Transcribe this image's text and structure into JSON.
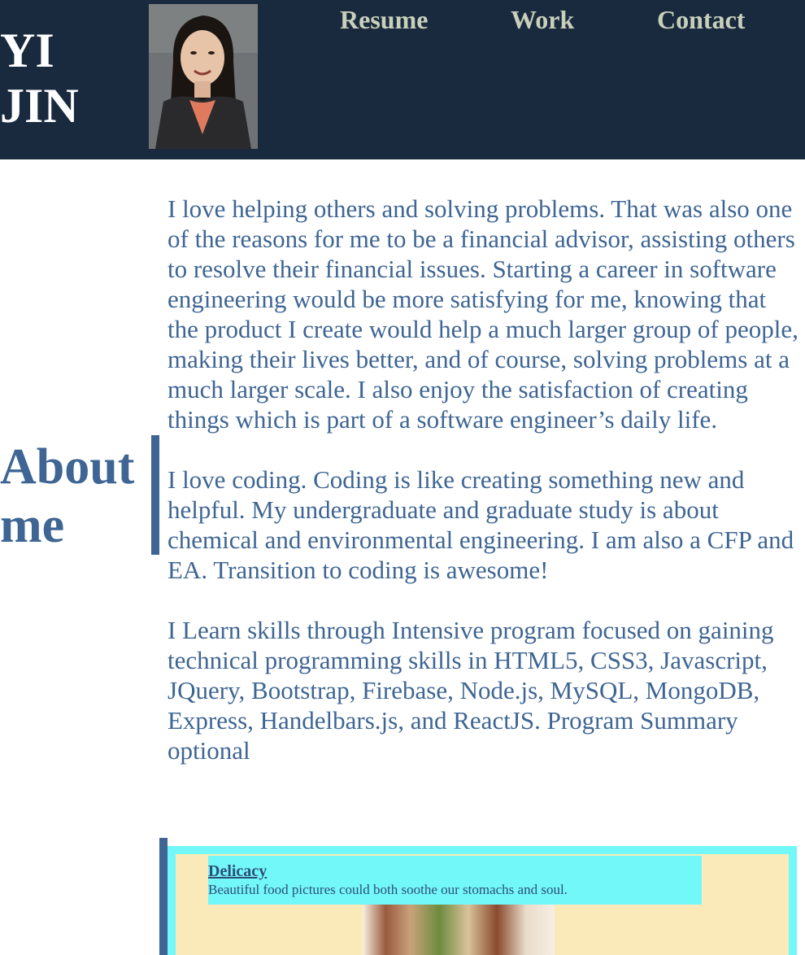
{
  "header": {
    "brand_line1": "YI",
    "brand_line2": "JIN",
    "avatar_alt": "profile photo",
    "nav": [
      {
        "label": "Resume"
      },
      {
        "label": "Work"
      },
      {
        "label": "Contact"
      }
    ]
  },
  "about": {
    "heading_line1": "About",
    "heading_line2": "me",
    "paragraphs": [
      "I love helping others and solving problems. That was also one of the reasons for me to be a financial advisor, assisting others to resolve their financial issues. Starting a career in software engineering would be more satisfying for me, knowing that the product I create would help a much larger group of people, making their lives better, and of course, solving problems at a much larger scale. I also enjoy the satisfaction of creating things which is part of a software engineer’s daily life.",
      "I love coding. Coding is like creating something new and helpful. My undergraduate and graduate study is about chemical and environmental engineering. I am also a CFP and EA. Transition to coding is awesome!",
      "I Learn skills through Intensive program focused on gaining technical programming skills in HTML5, CSS3, Javascript, JQuery, Bootstrap, Firebase, Node.js, MySQL, MongoDB, Express, Handelbars.js, and ReactJS. Program Summary optional"
    ]
  },
  "project": {
    "title": "Delicacy",
    "description": "Beautiful food pictures could both soothe our stomachs and soul."
  },
  "colors": {
    "header_bg": "#1a2a3e",
    "accent_blue": "#3e6593",
    "nav_text": "#c8d0bc",
    "card_cyan": "#73f8fa",
    "card_cream": "#fbeab9"
  }
}
